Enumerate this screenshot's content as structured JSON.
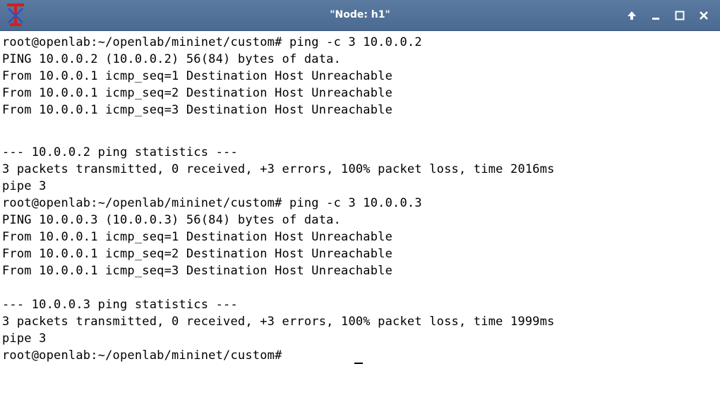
{
  "window": {
    "title": "\"Node: h1\"",
    "icon": "x-terminal-icon"
  },
  "controls": [
    {
      "name": "up-arrow-icon"
    },
    {
      "name": "minimize-icon"
    },
    {
      "name": "maximize-icon"
    },
    {
      "name": "close-icon"
    }
  ],
  "terminal": {
    "lines": [
      "root@openlab:~/openlab/mininet/custom# ping -c 3 10.0.0.2",
      "PING 10.0.0.2 (10.0.0.2) 56(84) bytes of data.",
      "From 10.0.0.1 icmp_seq=1 Destination Host Unreachable",
      "From 10.0.0.1 icmp_seq=2 Destination Host Unreachable",
      "From 10.0.0.1 icmp_seq=3 Destination Host Unreachable",
      "",
      "--- 10.0.0.2 ping statistics ---",
      "3 packets transmitted, 0 received, +3 errors, 100% packet loss, time 2016ms",
      "pipe 3",
      "root@openlab:~/openlab/mininet/custom# ping -c 3 10.0.0.3",
      "PING 10.0.0.3 (10.0.0.3) 56(84) bytes of data.",
      "From 10.0.0.1 icmp_seq=1 Destination Host Unreachable",
      "From 10.0.0.1 icmp_seq=2 Destination Host Unreachable",
      "From 10.0.0.1 icmp_seq=3 Destination Host Unreachable",
      "",
      "--- 10.0.0.3 ping statistics ---",
      "3 packets transmitted, 0 received, +3 errors, 100% packet loss, time 1999ms",
      "pipe 3",
      "root@openlab:~/openlab/mininet/custom# "
    ]
  },
  "colors": {
    "titlebar": "#4f6f97",
    "icon_red": "#d02020",
    "icon_blue": "#3050c0"
  }
}
